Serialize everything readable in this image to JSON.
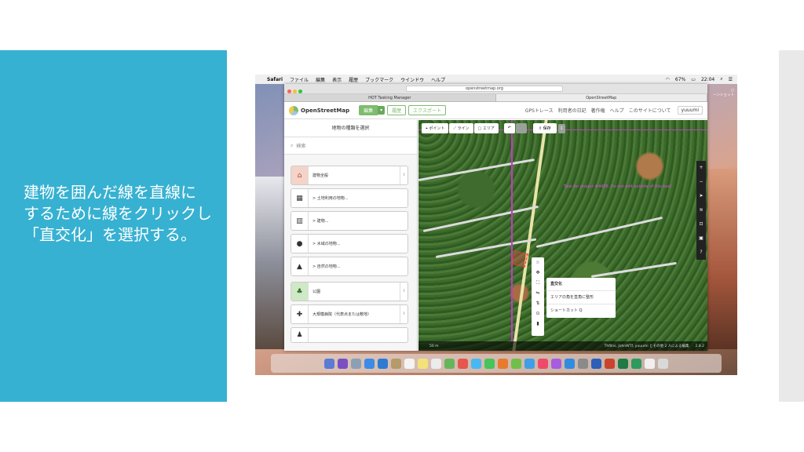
{
  "slide": {
    "caption": "建物を囲んだ線を直線にするために線をクリックし「直交化」を選択する。"
  },
  "menubar": {
    "app": "Safari",
    "items": [
      "ファイル",
      "編集",
      "表示",
      "履歴",
      "ブックマーク",
      "ウインドウ",
      "ヘルプ"
    ],
    "battery": "67%",
    "time": "22:04"
  },
  "browser": {
    "url": "openstreetmap.org",
    "tabs": [
      "HOT Tasking Manager",
      "OpenStreetMap"
    ]
  },
  "osm_header": {
    "logo": "OpenStreetMap",
    "edit": "編集",
    "history": "履歴",
    "export": "エクスポート",
    "links": [
      "GPSトレース",
      "利用者の日記",
      "著作権",
      "ヘルプ",
      "このサイトについて"
    ],
    "user": "yuuumi"
  },
  "sidebar": {
    "title": "地物の種類を選択",
    "search_placeholder": "検索",
    "presets": [
      {
        "label": "建物全般",
        "icon": "house-icon",
        "glyph": "⌂"
      },
      {
        "label": "> 土地利用の地物...",
        "icon": "land-use-icon",
        "glyph": "▦"
      },
      {
        "label": "> 建物...",
        "icon": "building-icon",
        "glyph": "▥"
      },
      {
        "label": "> 水域の地物...",
        "icon": "water-icon",
        "glyph": "●"
      },
      {
        "label": "> 自然の地物...",
        "icon": "nature-icon",
        "glyph": "▲"
      },
      {
        "label": "公園",
        "icon": "tree-icon",
        "glyph": "♣"
      },
      {
        "label": "大規模病院（代表点または敷地）",
        "icon": "hospital-icon",
        "glyph": "✚"
      }
    ]
  },
  "map_toolbar": {
    "point": "ポイント",
    "line": "ライン",
    "area": "エリア",
    "save": "保存",
    "edit_count": "1"
  },
  "map": {
    "task_label": "Task for project #4436. Do not edit outside of this box!",
    "context_menu": {
      "title": "直交化",
      "description": "エリアの角を直角に整形",
      "shortcut": "ショートカット Q"
    },
    "scale": "50 m",
    "attribution": "Thfilns, JohnWTf, yuuumi とその他 2 人による編集",
    "version": "2.8.2"
  },
  "colors": {
    "accent_band": "#37b1d1",
    "osm_green": "#7ebc6f",
    "task_boundary": "#c13cc1"
  }
}
